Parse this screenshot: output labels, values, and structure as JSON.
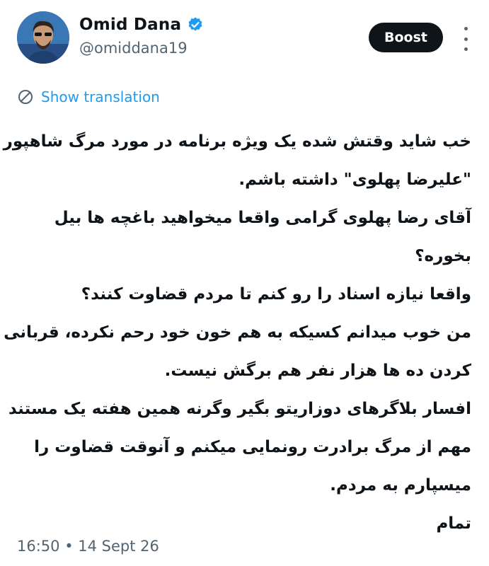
{
  "author": {
    "display_name": "Omid Dana",
    "handle": "@omiddana19",
    "verified": true
  },
  "actions": {
    "boost_label": "Boost"
  },
  "translation": {
    "label": "Show translation"
  },
  "tweet": {
    "lines": [
      "خب شاید وقتش شده یک ویژه برنامه در مورد مرگ شاهپور",
      "\"علیرضا پهلوی\" داشته باشم.",
      "آقای رضا پهلوی گرامی واقعا میخواهید باغچه ها بیل",
      "بخوره؟",
      "واقعا نیازه اسناد را رو کنم تا مردم قضاوت کنند؟",
      "من خوب میدانم کسیکه به هم خون خود رحم نکرده، قربانی",
      "کردن ده ها هزار نفر هم برگش نیست.",
      "افسار بلاگرهای دوزاریتو بگیر وگرنه همین هفته یک مستند",
      "مهم از مرگ برادرت رونمایی میکنم و آنوقت قضاوت را",
      "میسپارم به مردم.",
      "تمام"
    ]
  },
  "meta": {
    "timestamp": "16:50 • 14 Sept 26"
  },
  "colors": {
    "accent": "#1d9bf0",
    "text": "#0f1419",
    "secondary": "#536471"
  }
}
